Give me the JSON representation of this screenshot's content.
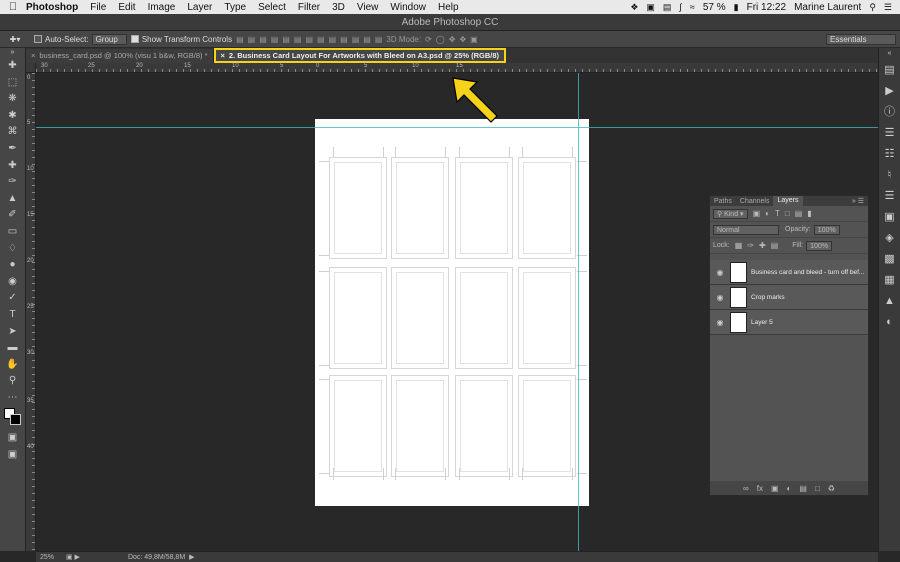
{
  "menubar": {
    "apple": "",
    "app_name": "Photoshop",
    "items": [
      "File",
      "Edit",
      "Image",
      "Layer",
      "Type",
      "Select",
      "Filter",
      "3D",
      "View",
      "Window",
      "Help"
    ],
    "battery": "57 %",
    "clock": "Fri 12:22",
    "user": "Marine Laurent"
  },
  "window": {
    "title": "Adobe Photoshop CC"
  },
  "options": {
    "auto_select_label": "Auto-Select:",
    "auto_select_value": "Group",
    "show_transform_label": "Show Transform Controls",
    "mode_3d_label": "3D Mode:",
    "workspace": "Essentials"
  },
  "tabs": [
    {
      "label": "business_card.psd @ 100% (visu 1 b&w, RGB/8) *",
      "active": false
    },
    {
      "label": "2. Business Card Layout For Artworks with Bleed on A3.psd @ 25% (RGB/8)",
      "active": true
    }
  ],
  "rulers": {
    "top": [
      "30",
      "25",
      "20",
      "15",
      "10",
      "5",
      "0",
      "5",
      "10",
      "15"
    ],
    "left": [
      "0",
      "5",
      "10",
      "15",
      "20",
      "25",
      "30",
      "35",
      "40"
    ]
  },
  "layers_panel": {
    "tabs": [
      "Paths",
      "Channels",
      "Layers"
    ],
    "kind_label": "Kind",
    "blend_mode": "Normal",
    "opacity_label": "Opacity:",
    "opacity_value": "100%",
    "lock_label": "Lock:",
    "fill_label": "Fill:",
    "fill_value": "100%",
    "layers": [
      {
        "name": "Business card and bleed - turn off bef..."
      },
      {
        "name": "Crop marks"
      },
      {
        "name": "Layer 5"
      }
    ]
  },
  "status": {
    "zoom": "25%",
    "doc": "Doc: 49,8M/58,8M"
  },
  "colors": {
    "highlight": "#f7d21a",
    "guide": "#3fb9c2"
  }
}
